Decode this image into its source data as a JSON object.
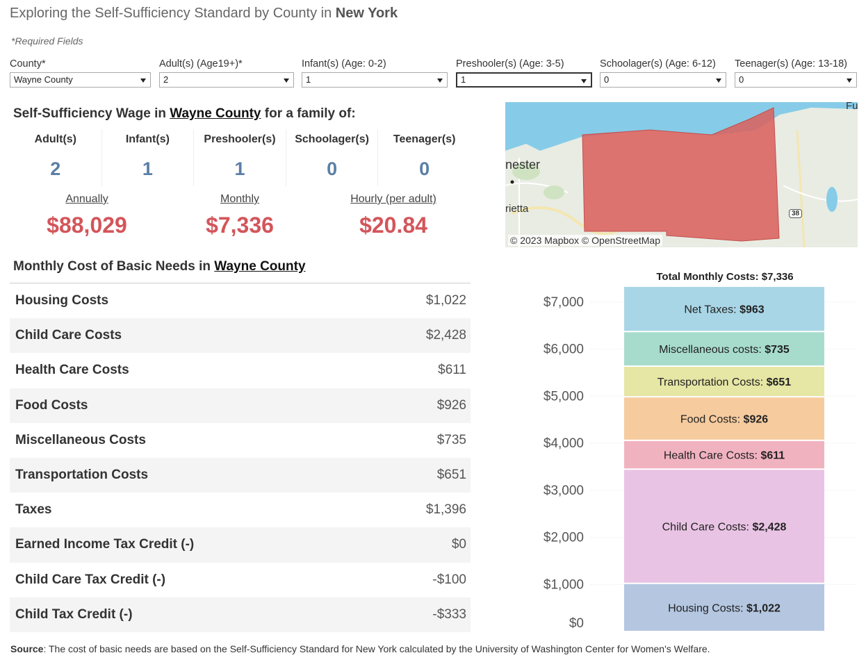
{
  "page": {
    "title_prefix": "Exploring the Self-Sufficiency Standard by County in ",
    "title_state": "New York",
    "required_note": "*Required Fields"
  },
  "filters": [
    {
      "label": "County*",
      "value": "Wayne County"
    },
    {
      "label": "Adult(s) (Age19+)*",
      "value": "2"
    },
    {
      "label": "Infant(s) (Age: 0-2)",
      "value": "1"
    },
    {
      "label": "Preshooler(s) (Age: 3-5)",
      "value": "1"
    },
    {
      "label": "Schoolager(s) (Age: 6-12)",
      "value": "0"
    },
    {
      "label": "Teenager(s) (Age: 13-18)",
      "value": "0"
    }
  ],
  "wage": {
    "heading_prefix": "Self-Sufficiency Wage in ",
    "county": "Wayne County",
    "heading_suffix": " for a family of:",
    "family": [
      {
        "label": "Adult(s)",
        "count": "2"
      },
      {
        "label": "Infant(s)",
        "count": "1"
      },
      {
        "label": "Preshooler(s)",
        "count": "1"
      },
      {
        "label": "Schoolager(s)",
        "count": "0"
      },
      {
        "label": "Teenager(s)",
        "count": "0"
      }
    ],
    "annual_label": "Annually",
    "annual_value": "$88,029",
    "monthly_label": "Monthly",
    "monthly_value": "$7,336",
    "hourly_label": "Hourly (per adult)",
    "hourly_value": "$20.84"
  },
  "map": {
    "attribution": "© 2023 Mapbox © OpenStreetMap",
    "labels": {
      "city1": "nester",
      "city2": "rietta",
      "corner": "Fu"
    },
    "route": "38",
    "county_fill": "#d9625f",
    "water": "#86cce8"
  },
  "needs": {
    "heading_prefix": "Monthly Cost of Basic Needs in ",
    "county": "Wayne County",
    "rows": [
      {
        "name": "Housing Costs",
        "amount": "$1,022"
      },
      {
        "name": "Child Care Costs",
        "amount": "$2,428"
      },
      {
        "name": "Health Care Costs",
        "amount": "$611"
      },
      {
        "name": "Food Costs",
        "amount": "$926"
      },
      {
        "name": "Miscellaneous Costs",
        "amount": "$735"
      },
      {
        "name": "Transportation Costs",
        "amount": "$651"
      },
      {
        "name": "Taxes",
        "amount": "$1,396"
      },
      {
        "name": "Earned Income Tax Credit (-)",
        "amount": "$0"
      },
      {
        "name": "Child Care Tax Credit (-)",
        "amount": "-$100"
      },
      {
        "name": "Child Tax Credit (-)",
        "amount": "-$333"
      }
    ]
  },
  "chart_data": {
    "type": "bar",
    "title": "Total Monthly Costs: $7,336",
    "ylim": [
      0,
      7336
    ],
    "yticks": [
      {
        "value": 0,
        "label": "$0"
      },
      {
        "value": 1000,
        "label": "$1,000"
      },
      {
        "value": 2000,
        "label": "$2,000"
      },
      {
        "value": 3000,
        "label": "$3,000"
      },
      {
        "value": 4000,
        "label": "$4,000"
      },
      {
        "value": 5000,
        "label": "$5,000"
      },
      {
        "value": 6000,
        "label": "$6,000"
      },
      {
        "value": 7000,
        "label": "$7,000"
      }
    ],
    "grid": true,
    "stacked": true,
    "segments": [
      {
        "name": "Housing Costs: ",
        "label": "$1,022",
        "value": 1022,
        "color": "#b4c6e0"
      },
      {
        "name": "Child Care Costs: ",
        "label": "$2,428",
        "value": 2428,
        "color": "#e9c3e4"
      },
      {
        "name": "Health Care Costs: ",
        "label": "$611",
        "value": 611,
        "color": "#f1b2c0"
      },
      {
        "name": "Food Costs: ",
        "label": "$926",
        "value": 926,
        "color": "#f6cb9e"
      },
      {
        "name": "Transportation Costs: ",
        "label": "$651",
        "value": 651,
        "color": "#e6e6a5"
      },
      {
        "name": "Miscellaneous costs: ",
        "label": "$735",
        "value": 735,
        "color": "#a7dccc"
      },
      {
        "name": "Net Taxes: ",
        "label": "$963",
        "value": 963,
        "color": "#a8d6e6"
      }
    ]
  },
  "source": {
    "label": "Source",
    "text": ": The cost of basic needs are based on the Self-Sufficiency Standard for New York calculated by the University of Washington Center for Women's Welfare."
  }
}
